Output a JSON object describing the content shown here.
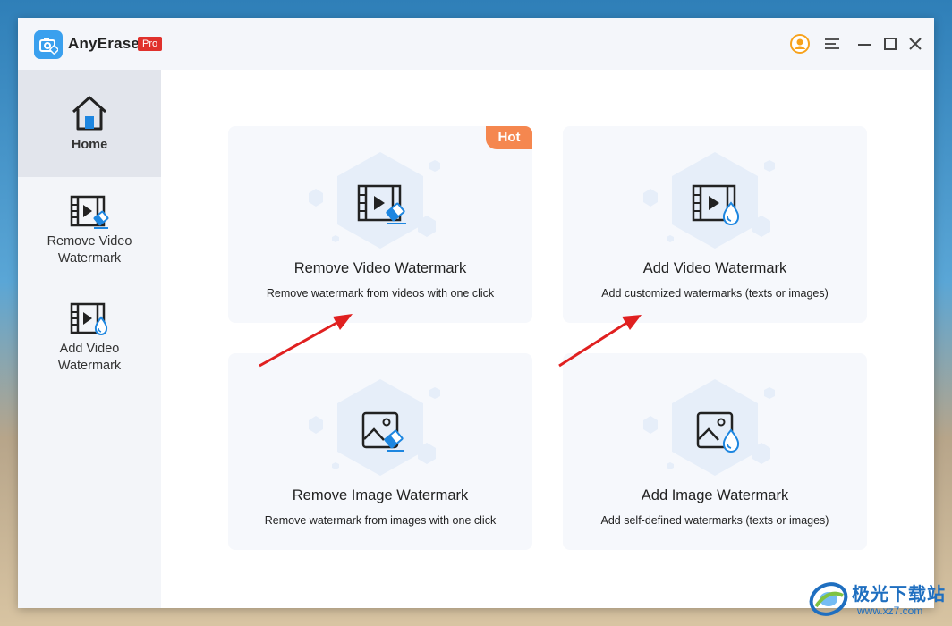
{
  "app": {
    "name": "AnyErase",
    "badge": "Pro"
  },
  "titlebar": {
    "icons": [
      "account-icon",
      "menu-icon",
      "minimize-icon",
      "maximize-icon",
      "close-icon"
    ]
  },
  "sidebar": {
    "items": [
      {
        "label": "Home",
        "icon": "home-icon",
        "active": true
      },
      {
        "label": "Remove Video Watermark",
        "icon": "remove-video-icon",
        "active": false
      },
      {
        "label": "Add Video Watermark",
        "icon": "add-video-icon",
        "active": false
      }
    ]
  },
  "cards": [
    {
      "title": "Remove Video Watermark",
      "desc": "Remove watermark from videos with one click",
      "badge": "Hot",
      "icon": "remove-video-watermark-icon"
    },
    {
      "title": "Add Video Watermark",
      "desc": "Add customized watermarks (texts or images)",
      "icon": "add-video-watermark-icon"
    },
    {
      "title": "Remove Image Watermark",
      "desc": "Remove watermark from images with one click",
      "icon": "remove-image-watermark-icon"
    },
    {
      "title": "Add Image Watermark",
      "desc": "Add self-defined watermarks  (texts or images)",
      "icon": "add-image-watermark-icon"
    }
  ],
  "site_watermark": {
    "text": "极光下载站",
    "url": "www.xz7.com"
  },
  "colors": {
    "accent": "#3aa0ee",
    "pro": "#e0312c",
    "hot": "#f5874f",
    "arrow": "#e02020",
    "hexagon": "#e6eef9"
  }
}
